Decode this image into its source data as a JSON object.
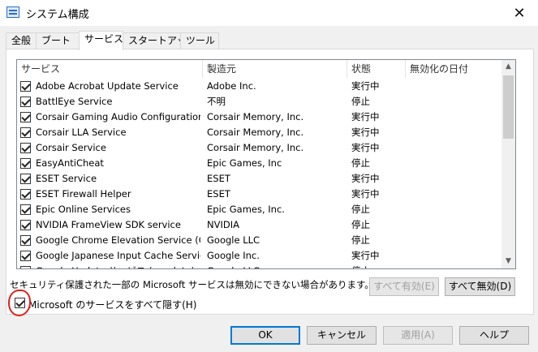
{
  "window": {
    "title": "システム構成",
    "close_glyph": "✕"
  },
  "tabs": [
    {
      "label": "全般"
    },
    {
      "label": "ブート"
    },
    {
      "label": "サービス"
    },
    {
      "label": "スタートアップ"
    },
    {
      "label": "ツール"
    }
  ],
  "active_tab": "サービス",
  "columns": [
    "サービス",
    "製造元",
    "状態",
    "無効化の日付"
  ],
  "services": [
    {
      "checked": true,
      "name": "Adobe Acrobat Update Service",
      "vendor": "Adobe Inc.",
      "status": "実行中",
      "disabled_date": ""
    },
    {
      "checked": true,
      "name": "BattlEye Service",
      "vendor": "不明",
      "status": "停止",
      "disabled_date": ""
    },
    {
      "checked": true,
      "name": "Corsair Gaming Audio Configuration...",
      "vendor": "Corsair Memory, Inc.",
      "status": "実行中",
      "disabled_date": ""
    },
    {
      "checked": true,
      "name": "Corsair LLA Service",
      "vendor": "Corsair Memory, Inc.",
      "status": "実行中",
      "disabled_date": ""
    },
    {
      "checked": true,
      "name": "Corsair Service",
      "vendor": "Corsair Memory, Inc.",
      "status": "実行中",
      "disabled_date": ""
    },
    {
      "checked": true,
      "name": "EasyAntiCheat",
      "vendor": "Epic Games, Inc",
      "status": "停止",
      "disabled_date": ""
    },
    {
      "checked": true,
      "name": "ESET Service",
      "vendor": "ESET",
      "status": "実行中",
      "disabled_date": ""
    },
    {
      "checked": true,
      "name": "ESET Firewall Helper",
      "vendor": "ESET",
      "status": "実行中",
      "disabled_date": ""
    },
    {
      "checked": true,
      "name": "Epic Online Services",
      "vendor": "Epic Games, Inc.",
      "status": "停止",
      "disabled_date": ""
    },
    {
      "checked": true,
      "name": "NVIDIA FrameView SDK service",
      "vendor": "NVIDIA",
      "status": "停止",
      "disabled_date": ""
    },
    {
      "checked": true,
      "name": "Google Chrome Elevation Service (G...",
      "vendor": "Google LLC",
      "status": "停止",
      "disabled_date": ""
    },
    {
      "checked": true,
      "name": "Google Japanese Input Cache Service",
      "vendor": "Google Inc.",
      "status": "実行中",
      "disabled_date": ""
    },
    {
      "checked": true,
      "name": "Google Update サービス (gupdate)",
      "vendor": "Google LLC",
      "status": "停止",
      "disabled_date": ""
    }
  ],
  "scrollbar": {
    "up_glyph": "▲",
    "down_glyph": "▼"
  },
  "note": "セキュリティ保護された一部の Microsoft サービスは無効にできない場合があります。",
  "buttons": {
    "enable_all": "すべて有効(E)",
    "disable_all": "すべて無効(D)",
    "ok": "OK",
    "cancel": "キャンセル",
    "apply": "適用(A)",
    "help": "ヘルプ"
  },
  "hide_ms": {
    "label": "Microsoft のサービスをすべて隠す(H)",
    "checked": true
  },
  "colors": {
    "accent": "#0078d7",
    "annotation_red": "#e0201b"
  }
}
